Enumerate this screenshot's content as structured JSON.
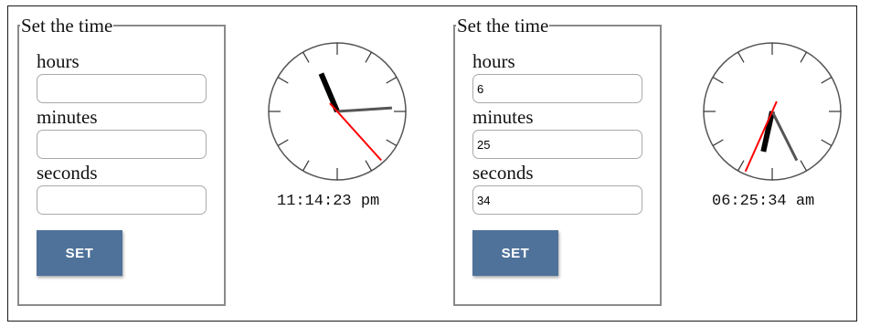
{
  "left_panel": {
    "legend": "Set the time",
    "hours_label": "hours",
    "minutes_label": "minutes",
    "seconds_label": "seconds",
    "hours_value": "",
    "minutes_value": "",
    "seconds_value": "",
    "button_label": "SET",
    "clock": {
      "time_text": "11:14:23 pm",
      "hours": 11,
      "minutes": 14,
      "seconds": 23
    }
  },
  "right_panel": {
    "legend": "Set the time",
    "hours_label": "hours",
    "minutes_label": "minutes",
    "seconds_label": "seconds",
    "hours_value": "6",
    "minutes_value": "25",
    "seconds_value": "34",
    "button_label": "SET",
    "clock": {
      "time_text": "06:25:34 am",
      "hours": 6,
      "minutes": 25,
      "seconds": 34
    }
  },
  "colors": {
    "button": "#4f729a",
    "second_hand": "#ff0000",
    "minute_hand": "#555555",
    "hour_hand": "#000000"
  }
}
